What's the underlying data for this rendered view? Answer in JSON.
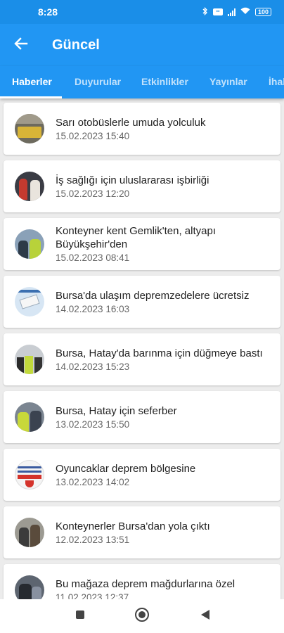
{
  "status": {
    "time": "8:28",
    "battery": "100"
  },
  "header": {
    "title": "Güncel"
  },
  "tabs": [
    "Haberler",
    "Duyurular",
    "Etkinlikler",
    "Yayınlar",
    "İhaleler"
  ],
  "news": [
    {
      "title": "Sarı otobüslerle umuda yolculuk",
      "date": "15.02.2023 15:40"
    },
    {
      "title": "İş sağlığı için uluslararası işbirliği",
      "date": "15.02.2023 12:20"
    },
    {
      "title": "Konteyner kent Gemlik'ten, altyapı Büyükşehir'den",
      "date": "15.02.2023 08:41"
    },
    {
      "title": "Bursa'da ulaşım depremzedelere ücretsiz",
      "date": "14.02.2023 16:03"
    },
    {
      "title": "Bursa, Hatay'da barınma için düğmeye bastı",
      "date": "14.02.2023 15:23"
    },
    {
      "title": "Bursa, Hatay için seferber",
      "date": "13.02.2023 15:50"
    },
    {
      "title": "Oyuncaklar deprem bölgesine",
      "date": "13.02.2023 14:02"
    },
    {
      "title": "Konteynerler Bursa'dan yola çıktı",
      "date": "12.02.2023 13:51"
    },
    {
      "title": "Bu mağaza deprem mağdurlarına özel",
      "date": "11.02.2023 12:37"
    }
  ],
  "colors": {
    "primary": "#2196f3",
    "status_bar": "#1a8ee8"
  }
}
